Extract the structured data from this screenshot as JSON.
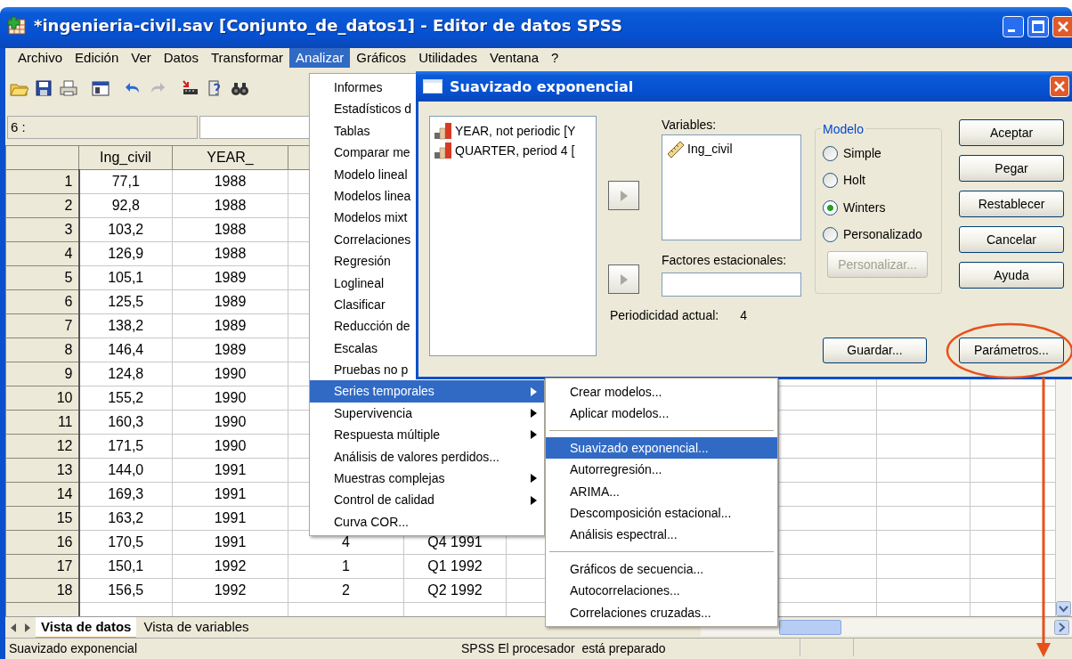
{
  "window": {
    "title": "*ingenieria-civil.sav [Conjunto_de_datos1] - Editor de datos SPSS"
  },
  "menu_bar": [
    {
      "label": "Archivo",
      "selected": false
    },
    {
      "label": "Edición",
      "selected": false
    },
    {
      "label": "Ver",
      "selected": false
    },
    {
      "label": "Datos",
      "selected": false
    },
    {
      "label": "Transformar",
      "selected": false
    },
    {
      "label": "Analizar",
      "selected": true
    },
    {
      "label": "Gráficos",
      "selected": false
    },
    {
      "label": "Utilidades",
      "selected": false
    },
    {
      "label": "Ventana",
      "selected": false
    },
    {
      "label": "?",
      "selected": false
    }
  ],
  "cell_bar": {
    "cell_ref": "6 :"
  },
  "table": {
    "columns": [
      "Ing_civil",
      "YEAR_"
    ],
    "rows": [
      {
        "number": "1",
        "cells": [
          "77,1",
          "1988"
        ]
      },
      {
        "number": "2",
        "cells": [
          "92,8",
          "1988"
        ]
      },
      {
        "number": "3",
        "cells": [
          "103,2",
          "1988"
        ]
      },
      {
        "number": "4",
        "cells": [
          "126,9",
          "1988"
        ]
      },
      {
        "number": "5",
        "cells": [
          "105,1",
          "1989"
        ]
      },
      {
        "number": "6",
        "cells": [
          "125,5",
          "1989"
        ]
      },
      {
        "number": "7",
        "cells": [
          "138,2",
          "1989"
        ]
      },
      {
        "number": "8",
        "cells": [
          "146,4",
          "1989"
        ]
      },
      {
        "number": "9",
        "cells": [
          "124,8",
          "1990"
        ]
      },
      {
        "number": "10",
        "cells": [
          "155,2",
          "1990"
        ]
      },
      {
        "number": "11",
        "cells": [
          "160,3",
          "1990"
        ]
      },
      {
        "number": "12",
        "cells": [
          "171,5",
          "1990"
        ]
      },
      {
        "number": "13",
        "cells": [
          "144,0",
          "1991"
        ]
      },
      {
        "number": "14",
        "cells": [
          "169,3",
          "1991"
        ]
      },
      {
        "number": "15",
        "cells": [
          "163,2",
          "1991"
        ]
      },
      {
        "number": "16",
        "cells": [
          "170,5",
          "1991",
          "4",
          "Q4 1991"
        ]
      },
      {
        "number": "17",
        "cells": [
          "150,1",
          "1992",
          "1",
          "Q1 1992"
        ]
      },
      {
        "number": "18",
        "cells": [
          "156,5",
          "1992",
          "2",
          "Q2 1992"
        ]
      }
    ]
  },
  "analyze_menu": {
    "items": [
      {
        "label": "Informes",
        "arrow": false,
        "selected": false
      },
      {
        "label": "Estadísticos d",
        "arrow": false,
        "selected": false
      },
      {
        "label": "Tablas",
        "arrow": false,
        "selected": false
      },
      {
        "label": "Comparar me",
        "arrow": false,
        "selected": false
      },
      {
        "label": "Modelo lineal",
        "arrow": false,
        "selected": false
      },
      {
        "label": "Modelos linea",
        "arrow": false,
        "selected": false
      },
      {
        "label": "Modelos mixt",
        "arrow": false,
        "selected": false
      },
      {
        "label": "Correlaciones",
        "arrow": false,
        "selected": false
      },
      {
        "label": "Regresión",
        "arrow": false,
        "selected": false
      },
      {
        "label": "Loglineal",
        "arrow": false,
        "selected": false
      },
      {
        "label": "Clasificar",
        "arrow": false,
        "selected": false
      },
      {
        "label": "Reducción de",
        "arrow": false,
        "selected": false
      },
      {
        "label": "Escalas",
        "arrow": false,
        "selected": false
      },
      {
        "label": "Pruebas no p",
        "arrow": false,
        "selected": false
      },
      {
        "label": "Series temporales",
        "arrow": true,
        "selected": true
      },
      {
        "label": "Supervivencia",
        "arrow": true,
        "selected": false
      },
      {
        "label": "Respuesta múltiple",
        "arrow": true,
        "selected": false
      },
      {
        "label": "Análisis de valores perdidos...",
        "arrow": false,
        "selected": false
      },
      {
        "label": "Muestras complejas",
        "arrow": true,
        "selected": false
      },
      {
        "label": "Control de calidad",
        "arrow": true,
        "selected": false
      },
      {
        "label": "Curva COR...",
        "arrow": false,
        "selected": false
      }
    ]
  },
  "submenu": {
    "items": [
      {
        "kind": "item",
        "label": "Crear modelos...",
        "selected": false
      },
      {
        "kind": "item",
        "label": "Aplicar modelos...",
        "selected": false
      },
      {
        "kind": "separator"
      },
      {
        "kind": "item",
        "label": "Suavizado exponencial...",
        "selected": true
      },
      {
        "kind": "item",
        "label": "Autorregresión...",
        "selected": false
      },
      {
        "kind": "item",
        "label": "ARIMA...",
        "selected": false
      },
      {
        "kind": "item",
        "label": "Descomposición estacional...",
        "selected": false
      },
      {
        "kind": "item",
        "label": "Análisis espectral...",
        "selected": false
      },
      {
        "kind": "separator"
      },
      {
        "kind": "item",
        "label": "Gráficos de secuencia...",
        "selected": false
      },
      {
        "kind": "item",
        "label": "Autocorrelaciones...",
        "selected": false
      },
      {
        "kind": "item",
        "label": "Correlaciones cruzadas...",
        "selected": false
      }
    ]
  },
  "dialog": {
    "title": "Suavizado exponencial",
    "source_list": [
      "YEAR, not periodic [Y",
      "QUARTER, period 4 ["
    ],
    "variables_label": "Variables:",
    "variables": [
      "Ing_civil"
    ],
    "seasonal_label": "Factores estacionales:",
    "periodicity_label": "Periodicidad actual:",
    "periodicity_value": "4",
    "model_group": {
      "legend": "Modelo",
      "options": [
        {
          "label": "Simple",
          "selected": false
        },
        {
          "label": "Holt",
          "selected": false
        },
        {
          "label": "Winters",
          "selected": true
        },
        {
          "label": "Personalizado",
          "selected": false
        }
      ],
      "custom_button": {
        "label": "Personalizar...",
        "disabled": true
      }
    },
    "buttons": [
      "Aceptar",
      "Pegar",
      "Restablecer",
      "Cancelar",
      "Ayuda"
    ],
    "save_button": "Guardar...",
    "params_button": "Parámetros..."
  },
  "tabs": [
    {
      "label": "Vista de datos",
      "selected": true
    },
    {
      "label": "Vista de variables",
      "selected": false
    }
  ],
  "status_bar": {
    "left": "Suavizado exponencial",
    "processor": "SPSS El procesador  está preparado"
  }
}
